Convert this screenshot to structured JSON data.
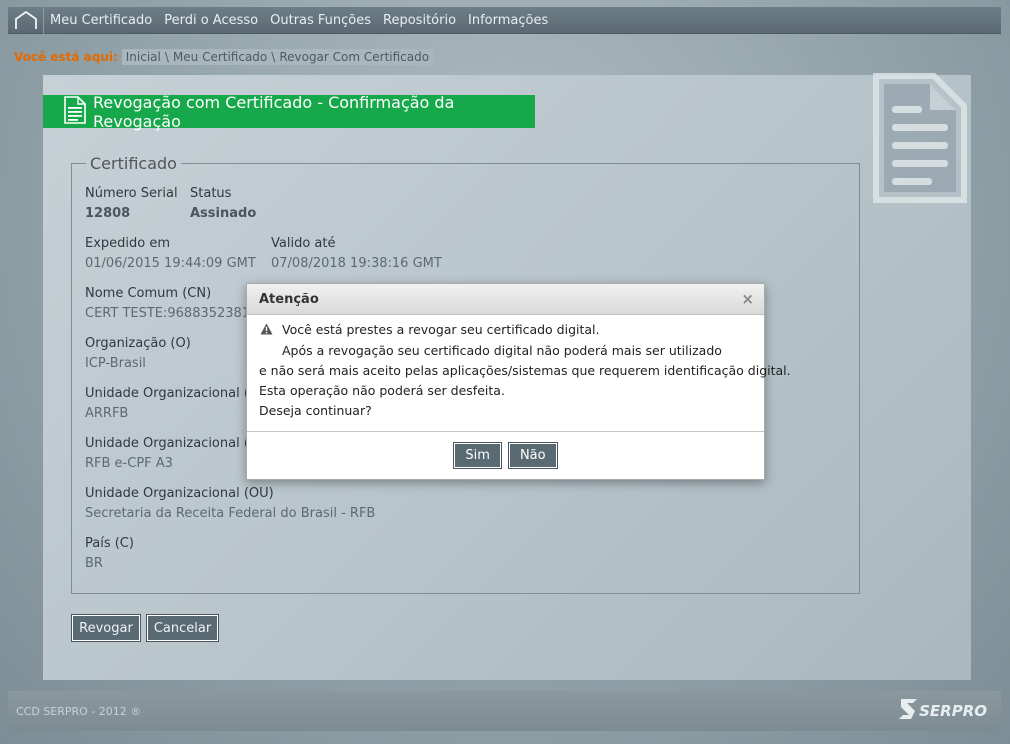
{
  "nav": {
    "items": [
      "Meu Certificado",
      "Perdi o Acesso",
      "Outras Funções",
      "Repositório",
      "Informações"
    ]
  },
  "breadcrumb": {
    "label": "Você está aqui:",
    "items": [
      "Inicial",
      "Meu Certificado",
      "Revogar Com Certificado"
    ],
    "separator": "\\"
  },
  "page": {
    "title": "Revogação com Certificado - Confirmação da Revogação"
  },
  "certificate": {
    "legend": "Certificado",
    "serial_label": "Número Serial",
    "serial_value": "12808",
    "status_label": "Status",
    "status_value": "Assinado",
    "issued_label": "Expedido em",
    "issued_value": "01/06/2015 19:44:09 GMT",
    "valid_label": "Valido até",
    "valid_value": "07/08/2018 19:38:16 GMT",
    "cn_label": "Nome Comum (CN)",
    "cn_value": "CERT TESTE:9688352381",
    "org_label": "Organização (O)",
    "org_value": "ICP-Brasil",
    "ou1_label": "Unidade Organizacional (OU)",
    "ou1_value": "ARRFB",
    "ou2_label": "Unidade Organizacional (OU)",
    "ou2_value": "RFB e-CPF A3",
    "ou3_label": "Unidade Organizacional (OU)",
    "ou3_value": "Secretaria da Receita Federal do Brasil - RFB",
    "country_label": "País (C)",
    "country_value": "BR"
  },
  "actions": {
    "revoke": "Revogar",
    "cancel": "Cancelar"
  },
  "footer": {
    "copyright": "CCD SERPRO - 2012 ®",
    "logo_text": "SERPRO"
  },
  "dialog": {
    "title": "Atenção",
    "close": "×",
    "line1": "Você está prestes a revogar seu certificado digital.",
    "line2": "Após a revogação seu certificado digital não poderá mais ser utilizado",
    "line3": "e não será mais aceito pelas aplicações/sistemas que requerem identificação digital.",
    "line4": "Esta operação não poderá ser desfeita.",
    "line5": "Deseja continuar?",
    "yes": "Sim",
    "no": "Não"
  },
  "colors": {
    "title_bar": "#16a84a",
    "breadcrumb_label": "#e36a00",
    "button": "#5a6a73"
  }
}
